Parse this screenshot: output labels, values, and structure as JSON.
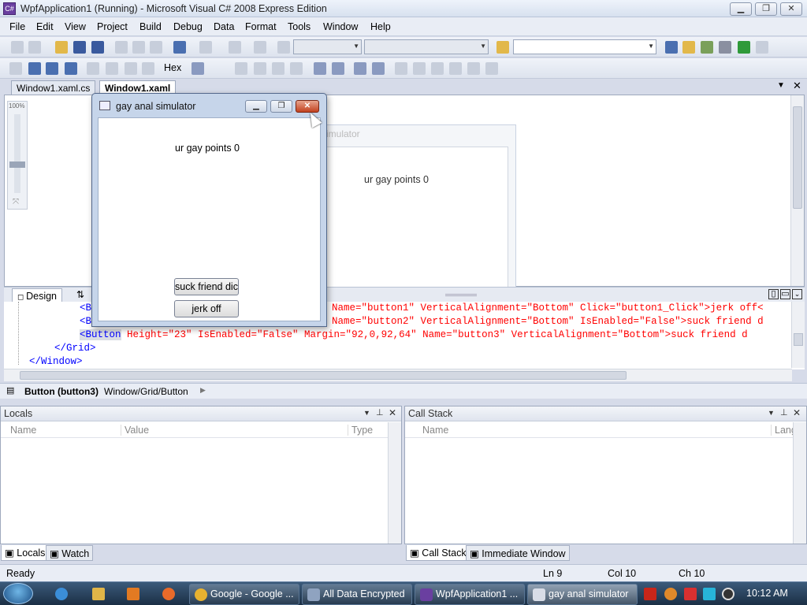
{
  "window": {
    "title": "WpfApplication1 (Running) - Microsoft Visual C# 2008 Express Edition",
    "minimize": "▁",
    "maximize": "❐",
    "close": "✕"
  },
  "menu": [
    "File",
    "Edit",
    "View",
    "Project",
    "Build",
    "Debug",
    "Data",
    "Format",
    "Tools",
    "Window",
    "Help"
  ],
  "toolbar": {
    "hex_label": "Hex"
  },
  "doc_tabs": [
    {
      "label": "Window1.xaml.cs",
      "active": false
    },
    {
      "label": "Window1.xaml",
      "active": true
    }
  ],
  "designer": {
    "zoom_label": "100%",
    "preview_title": "imulator",
    "preview_points": "ur gay points 0"
  },
  "split": {
    "design_tab": "Design",
    "swap_icon": "⇅"
  },
  "xaml_lines": [
    {
      "prefix": "<B",
      "name_part": "Name=\"button1\" VerticalAlignment=\"Bottom\" Click=\"button1_Click\">jerk off<"
    },
    {
      "prefix": "<B",
      "name_part": "Name=\"button2\" VerticalAlignment=\"Bottom\" IsEnabled=\"False\">suck friend d"
    },
    {
      "prefix": "<Button",
      "name_part": " Height=\"23\" IsEnabled=\"False\" Margin=\"92,0,92,64\" Name=\"button3\" VerticalAlignment=\"Bottom\">suck friend d"
    },
    {
      "prefix": "</Grid>",
      "name_part": ""
    },
    {
      "prefix": "</Window>",
      "name_part": ""
    }
  ],
  "breadcrumb": {
    "bold": "Button (button3)",
    "path": "Window/Grid/Button"
  },
  "locals_panel": {
    "title": "Locals",
    "cols": [
      "Name",
      "Value",
      "Type"
    ]
  },
  "callstack_panel": {
    "title": "Call Stack",
    "cols": [
      "Name",
      "Lang"
    ]
  },
  "bottom_tabs_left": [
    "Locals",
    "Watch"
  ],
  "bottom_tabs_right": [
    "Call Stack",
    "Immediate Window"
  ],
  "status": {
    "ready": "Ready",
    "ln": "Ln 9",
    "col": "Col 10",
    "ch": "Ch 10"
  },
  "running_app": {
    "title": "gay anal simulator",
    "points_text": "ur gay points 0",
    "button_suck": "suck friend dic",
    "button_jerk": "jerk off"
  },
  "taskbar": {
    "items": [
      {
        "label": "Google - Google ...",
        "active": false,
        "color": "#e8b230"
      },
      {
        "label": "All Data Encrypted",
        "active": false,
        "color": "#8fa3c0"
      },
      {
        "label": "WpfApplication1 ...",
        "active": false,
        "color": "#6a3fa0"
      },
      {
        "label": "gay anal simulator",
        "active": true,
        "color": "#d8dde7"
      }
    ],
    "clock": "10:12 AM"
  }
}
